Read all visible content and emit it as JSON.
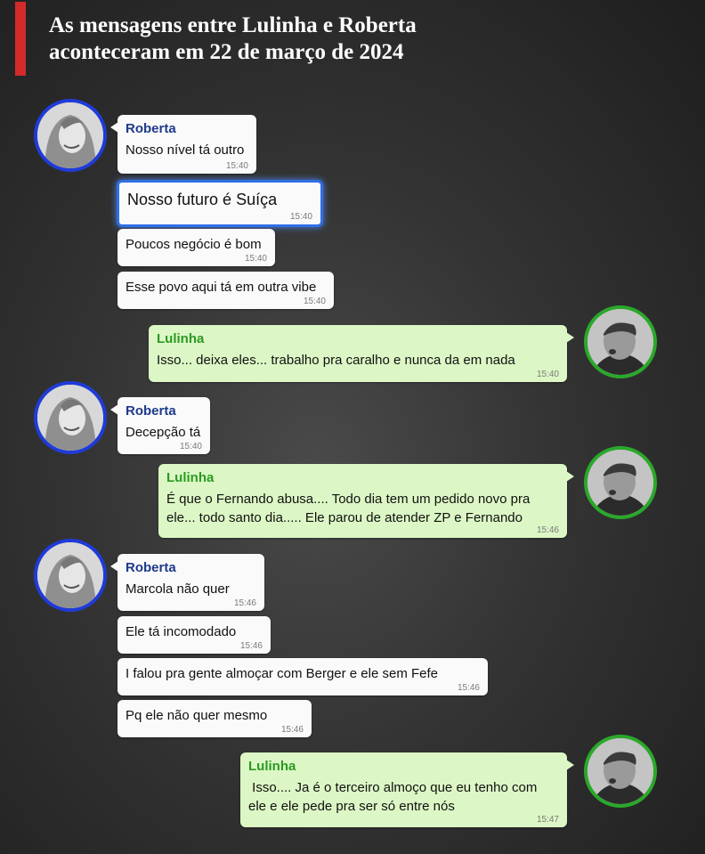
{
  "header": {
    "title_line1": "As mensagens entre Lulinha e Roberta",
    "title_line2": "aconteceram em 22 de março de 2024",
    "accent_color": "#d12b2b"
  },
  "participants": {
    "roberta": {
      "name": "Roberta",
      "ring_color": "#1f3bd8",
      "name_color": "#1e3a8a"
    },
    "lulinha": {
      "name": "Lulinha",
      "ring_color": "#2aa82a",
      "name_color": "#2a9a22"
    }
  },
  "messages": [
    {
      "sender": "Roberta",
      "text": "Nosso nível tá outro",
      "time": "15:40"
    },
    {
      "text": "Nosso futuro é Suíça",
      "time": "15:40",
      "highlighted": true
    },
    {
      "text": "Poucos negócio é bom",
      "time": "15:40"
    },
    {
      "text": "Esse povo aqui tá em outra vibe",
      "time": "15:40"
    },
    {
      "sender": "Lulinha",
      "text": "Isso... deixa eles... trabalho pra caralho e nunca da em nada",
      "time": "15:40"
    },
    {
      "sender": "Roberta",
      "text": "Decepção tá",
      "time": "15:40"
    },
    {
      "sender": "Lulinha",
      "text_line1": "É que o Fernando abusa.... Todo dia tem um pedido novo pra",
      "text_line2": "ele... todo santo dia..... Ele parou de atender ZP e Fernando",
      "time": "15:46"
    },
    {
      "sender": "Roberta",
      "text": "Marcola não quer",
      "time": "15:46"
    },
    {
      "text": "Ele tá incomodado",
      "time": "15:46"
    },
    {
      "text": "I falou pra gente almoçar com Berger e ele sem Fefe",
      "time": "15:46"
    },
    {
      "text": "Pq ele não quer mesmo",
      "time": "15:46"
    },
    {
      "sender": "Lulinha",
      "text_line1": " Isso.... Ja é o terceiro almoço que eu tenho com",
      "text_line2": "ele e ele pede pra ser só entre nós",
      "time": "15:47"
    }
  ]
}
